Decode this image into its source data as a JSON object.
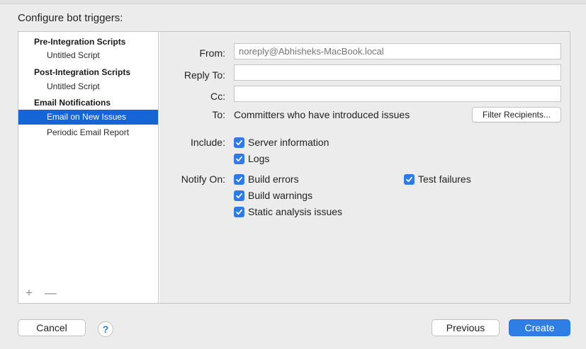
{
  "heading": "Configure bot triggers:",
  "sidebar": {
    "pre_header": "Pre-Integration Scripts",
    "pre_item": "Untitled Script",
    "post_header": "Post-Integration Scripts",
    "post_item": "Untitled Script",
    "email_header": "Email Notifications",
    "email_selected": "Email on New Issues",
    "email_periodic": "Periodic Email Report",
    "add": "+",
    "remove": "—"
  },
  "form": {
    "from_label": "From:",
    "from_placeholder": "noreply@Abhisheks-MacBook.local",
    "reply_label": "Reply To:",
    "reply_value": "",
    "cc_label": "Cc:",
    "cc_value": "",
    "to_label": "To:",
    "to_value": "Committers who have introduced issues",
    "filter_button": "Filter Recipients...",
    "include_label": "Include:",
    "include_options": [
      "Server information",
      "Logs"
    ],
    "notify_label": "Notify On:",
    "notify_options": [
      "Build errors",
      "Build warnings",
      "Static analysis issues",
      "Test failures"
    ]
  },
  "footer": {
    "cancel": "Cancel",
    "help": "?",
    "previous": "Previous",
    "create": "Create"
  },
  "colors": {
    "accent": "#2f7ae5",
    "selection": "#1565d6"
  }
}
